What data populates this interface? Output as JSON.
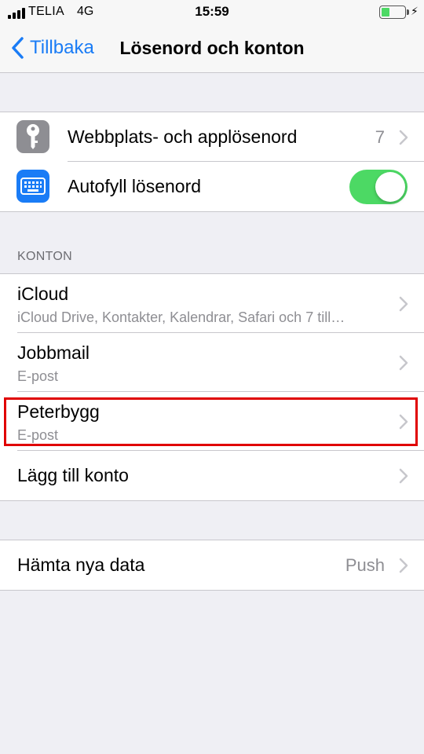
{
  "status_bar": {
    "carrier": "TELIA",
    "network": "4G",
    "time": "15:59",
    "battery_level": 0.35,
    "signal_bars": 4
  },
  "nav": {
    "back_label": "Tillbaka",
    "title": "Lösenord och konton"
  },
  "passwords_group": {
    "website_passwords": {
      "label": "Webbplats- och applösenord",
      "count": "7",
      "icon": "key-icon"
    },
    "autofill": {
      "label": "Autofyll lösenord",
      "enabled": true,
      "icon": "keyboard-icon"
    }
  },
  "accounts": {
    "header": "KONTON",
    "items": [
      {
        "name": "iCloud",
        "detail": "iCloud Drive, Kontakter, Kalendrar, Safari och 7 till…"
      },
      {
        "name": "Jobbmail",
        "detail": "E-post"
      },
      {
        "name": "Peterbygg",
        "detail": "E-post"
      }
    ],
    "add_account": "Lägg till konto"
  },
  "fetch": {
    "label": "Hämta nya data",
    "value": "Push"
  },
  "colors": {
    "accent": "#1a7cf6",
    "toggle_on": "#4cd964",
    "highlight": "#e00000",
    "background": "#efeff4"
  }
}
